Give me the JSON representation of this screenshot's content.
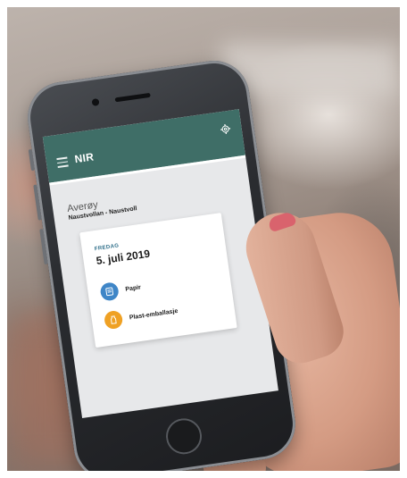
{
  "app": {
    "title": "NIR",
    "header_color": "#3f6e67"
  },
  "location": {
    "municipality": "Averøy",
    "address": "Naustvollan - Naustvoll"
  },
  "collection": {
    "day": "FREDAG",
    "date": "5. juli 2019",
    "items": [
      {
        "label": "Papir",
        "icon": "paper-recycle-icon",
        "color": "#3f86c7"
      },
      {
        "label": "Plast-emballasje",
        "icon": "plastic-recycle-icon",
        "color": "#efa124"
      }
    ]
  },
  "icons": {
    "menu": "menu-icon",
    "settings": "gear-icon"
  }
}
